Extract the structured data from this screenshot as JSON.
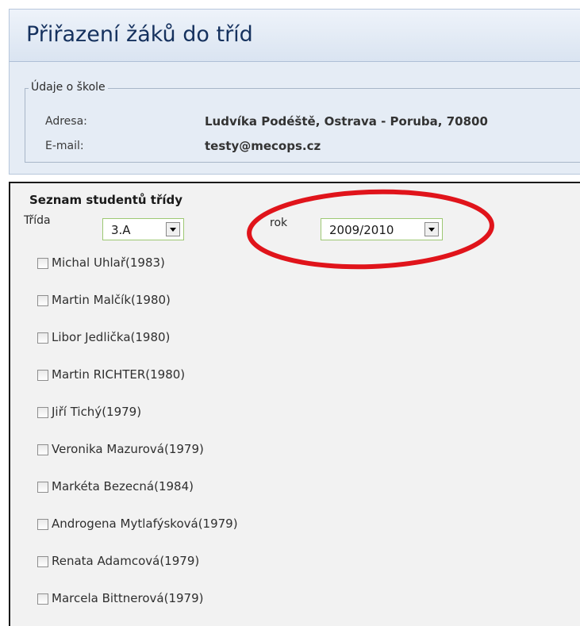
{
  "page": {
    "title": "Přiřazení žáků do tříd"
  },
  "school": {
    "legend": "Údaje o škole",
    "address_label": "Adresa:",
    "address_value": "Ludvíka Podéště, Ostrava - Poruba, 70800",
    "email_label": "E-mail:",
    "email_value": "testy@mecops.cz"
  },
  "students": {
    "title": "Seznam studentů třídy",
    "class_label": "Třída",
    "class_value": "3.A",
    "year_label": "rok",
    "year_value": "2009/2010",
    "items": [
      {
        "label": "Michal Uhlař(1983)"
      },
      {
        "label": "Martin Malčík(1980)"
      },
      {
        "label": "Libor Jedlička(1980)"
      },
      {
        "label": "Martin RICHTER(1980)"
      },
      {
        "label": "Jiří Tichý(1979)"
      },
      {
        "label": "Veronika Mazurová(1979)"
      },
      {
        "label": "Markéta Bezecná(1984)"
      },
      {
        "label": "Androgena Mytlafýsková(1979)"
      },
      {
        "label": "Renata Adamcová(1979)"
      },
      {
        "label": "Marcela Bittnerová(1979)"
      }
    ]
  },
  "annotation": {
    "color": "#e0141b"
  }
}
